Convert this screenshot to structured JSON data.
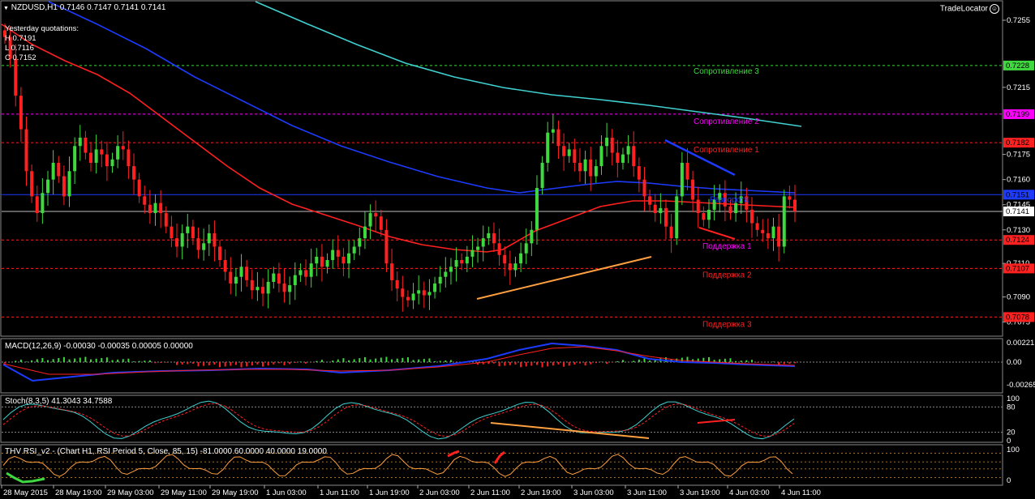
{
  "header": {
    "symbol": "NZDUSD,H1",
    "ohlc": "0.7146 0.7147 0.7141 0.7141",
    "arrow_icon": "triangle-down-icon"
  },
  "yesterday": {
    "title": "Yesterday quotations:",
    "high": "H 0.7191",
    "low": "L 0.7116",
    "close": "C 0.7152"
  },
  "tradelocator": {
    "label": "TradeLocator",
    "icon": "circle-logo-icon"
  },
  "main_axis": {
    "ticks": [
      "0.7255",
      "0.7215",
      "0.7175",
      "0.7130",
      "0.7090",
      "0.7075"
    ],
    "extra_ticks": [
      "0.7160",
      "0.7145",
      "0.7110"
    ],
    "price_marks": [
      {
        "label": "0.7228",
        "color": "#3fd83f"
      },
      {
        "label": "0.7199",
        "color": "#ff00ff"
      },
      {
        "label": "0.7182",
        "color": "#ff2020"
      },
      {
        "label": "0.7151",
        "color": "#1d3bff"
      },
      {
        "label": "0.7141",
        "color": "#ffffff"
      },
      {
        "label": "0.7124",
        "color": "#ff2020"
      },
      {
        "label": "0.7107",
        "color": "#ff2020"
      },
      {
        "label": "0.7078",
        "color": "#ff2020"
      }
    ]
  },
  "levels": {
    "r3": {
      "label": "Сопротивление 3",
      "color": "#3fd83f"
    },
    "r2": {
      "label": "Сопротивление 2",
      "color": "#ff00ff"
    },
    "r1": {
      "label": "Сопротивление 1",
      "color": "#ff2020"
    },
    "pivot": {
      "label": "Разворота",
      "color": "#1d3bff"
    },
    "s1": {
      "label": "Поддержка 1",
      "color": "#ff00ff"
    },
    "s2": {
      "label": "Поддержка 2",
      "color": "#ff2020"
    },
    "s3": {
      "label": "Поддержка 3",
      "color": "#ff2020"
    }
  },
  "macd": {
    "label": "MACD(12,26,9) -0.00030 -0.00035 0.00005 0.00000",
    "ticks": [
      "0.00221",
      "0.00",
      "-0.00265"
    ]
  },
  "stoch": {
    "label": "Stoch(8,3,5) 41.3043 34.7588",
    "ticks": [
      "100",
      "80",
      "20",
      "0"
    ]
  },
  "rsi": {
    "label": "THV RSI_v2 - (Chart H1, RSI Period 5, Close, 85, 15) -81.0000 60.0000 40.0000 19.0000",
    "ticks": [
      "100",
      "0"
    ]
  },
  "time_axis": [
    "28 May 2015",
    "28 May 19:00",
    "29 May 03:00",
    "29 May 11:00",
    "29 May 19:00",
    "1 Jun 03:00",
    "1 Jun 11:00",
    "1 Jun 19:00",
    "2 Jun 03:00",
    "2 Jun 11:00",
    "2 Jun 19:00",
    "3 Jun 03:00",
    "3 Jun 11:00",
    "3 Jun 19:00",
    "4 Jun 03:00",
    "4 Jun 11:00"
  ],
  "colors": {
    "bull": "#3fd83f",
    "bear": "#ff2020",
    "ma_red": "#ff2020",
    "ma_blue": "#1d3bff",
    "ma_cyan": "#40d0d0",
    "grid": "#888888"
  }
}
